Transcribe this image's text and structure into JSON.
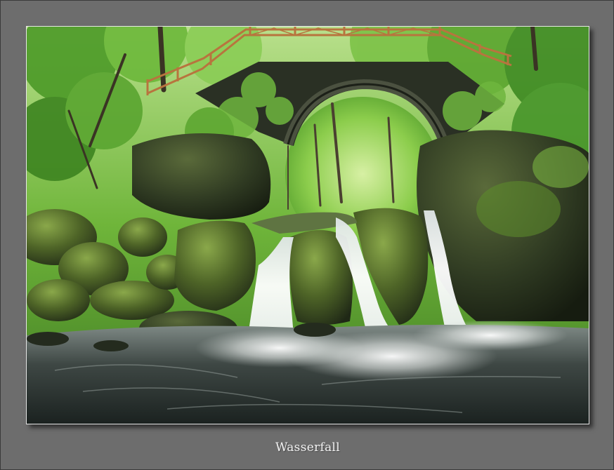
{
  "caption": "Wasserfall",
  "colors": {
    "frame": "#6d6d6d",
    "photo_border": "#e8e8e8",
    "foliage": "#5fa531",
    "moss": "#4f6a22",
    "rock": "#2c3322",
    "water": "#f2f4f4",
    "railing": "#b8743e"
  }
}
